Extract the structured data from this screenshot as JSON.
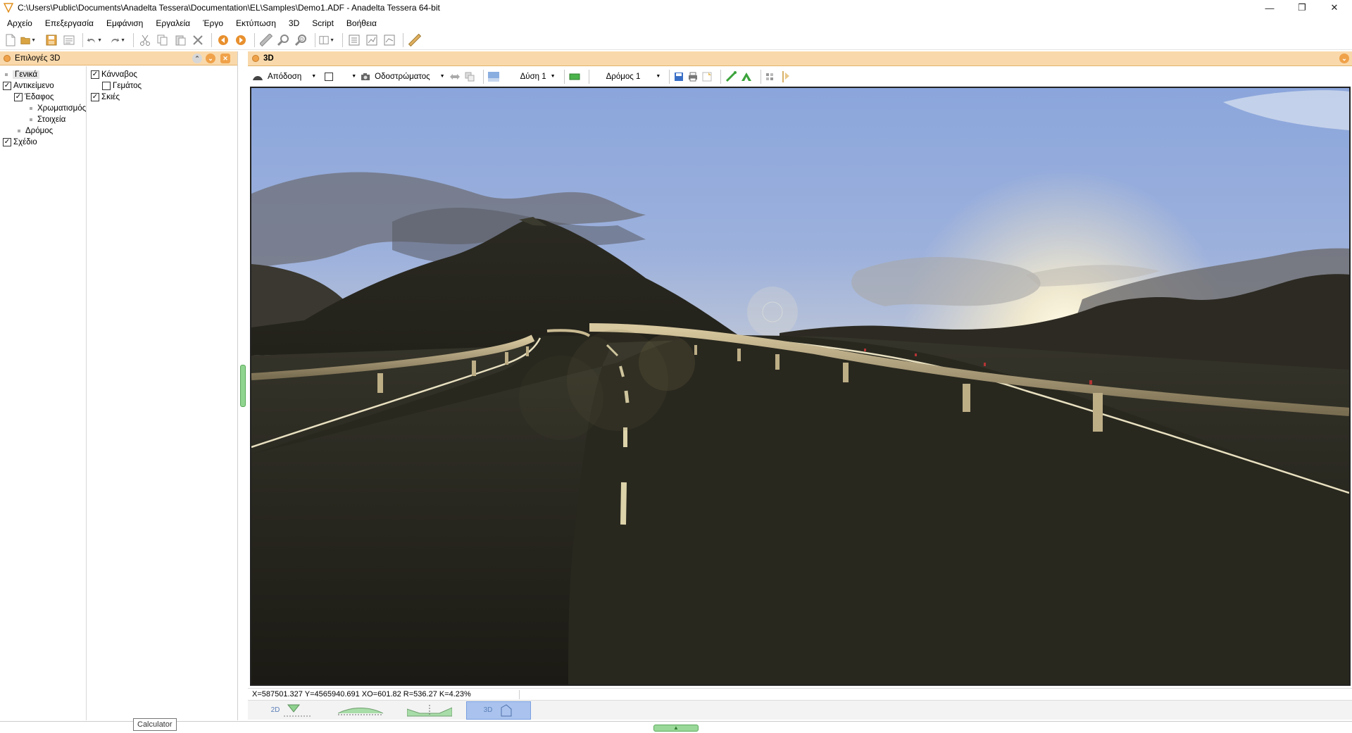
{
  "window": {
    "title": "C:\\Users\\Public\\Documents\\Anadelta Tessera\\Documentation\\EL\\Samples\\Demo1.ADF - Anadelta Tessera 64-bit",
    "controls": [
      "—",
      "❐",
      "✕"
    ]
  },
  "menu": [
    "Αρχείο",
    "Επεξεργασία",
    "Εμφάνιση",
    "Εργαλεία",
    "Έργο",
    "Εκτύπωση",
    "3D",
    "Script",
    "Βοήθεια"
  ],
  "toolbar": {
    "icons": [
      "new-file-icon",
      "open-folder-icon",
      "save-icon",
      "properties-icon",
      "undo-icon",
      "redo-icon",
      "cut-icon",
      "copy-icon",
      "paste-icon",
      "delete-icon",
      "back-icon",
      "forward-icon",
      "ruler-icon",
      "zoom-icon",
      "zoom-window-icon",
      "layout-icon",
      "panel-list-icon",
      "chart-icon",
      "profile-icon",
      "measure-icon"
    ]
  },
  "left_panel": {
    "title": "Επιλογές 3D",
    "tree": [
      {
        "label": "Γενικά",
        "selected": true
      },
      {
        "label": "Αντικείμενο",
        "checked": true
      },
      {
        "label": "Έδαφος",
        "checked": true
      },
      {
        "label": "Χρωματισμός"
      },
      {
        "label": "Στοιχεία"
      },
      {
        "label": "Δρόμος"
      },
      {
        "label": "Σχέδιο",
        "checked": true
      }
    ],
    "options": [
      {
        "label": "Κάνναβος",
        "checked": true
      },
      {
        "label": "Γεμάτος",
        "checked": false
      },
      {
        "label": "Σκιές",
        "checked": true
      }
    ]
  },
  "document": {
    "title": "3D",
    "viewbar": {
      "render_label": "Απόδοση",
      "camera_label": "Οδοστρώματος",
      "sunset_label": "Δύση 1",
      "road_label": "Δρόμος 1"
    }
  },
  "status": {
    "coords": "X=587501.327  Y=4565940.691  XO=601.82 R=536.27 K=4.23%"
  },
  "bottom_tabs": [
    {
      "label": "2D",
      "active": false
    },
    {
      "label": "",
      "active": false
    },
    {
      "label": "",
      "active": false
    },
    {
      "label": "3D",
      "active": true
    }
  ],
  "tooltip": "Calculator",
  "colors": {
    "panel_header": "#f9d9ab",
    "accent_orange": "#f0a24a",
    "active_tab": "#aac3ee",
    "grip_green": "#8fd48f"
  }
}
